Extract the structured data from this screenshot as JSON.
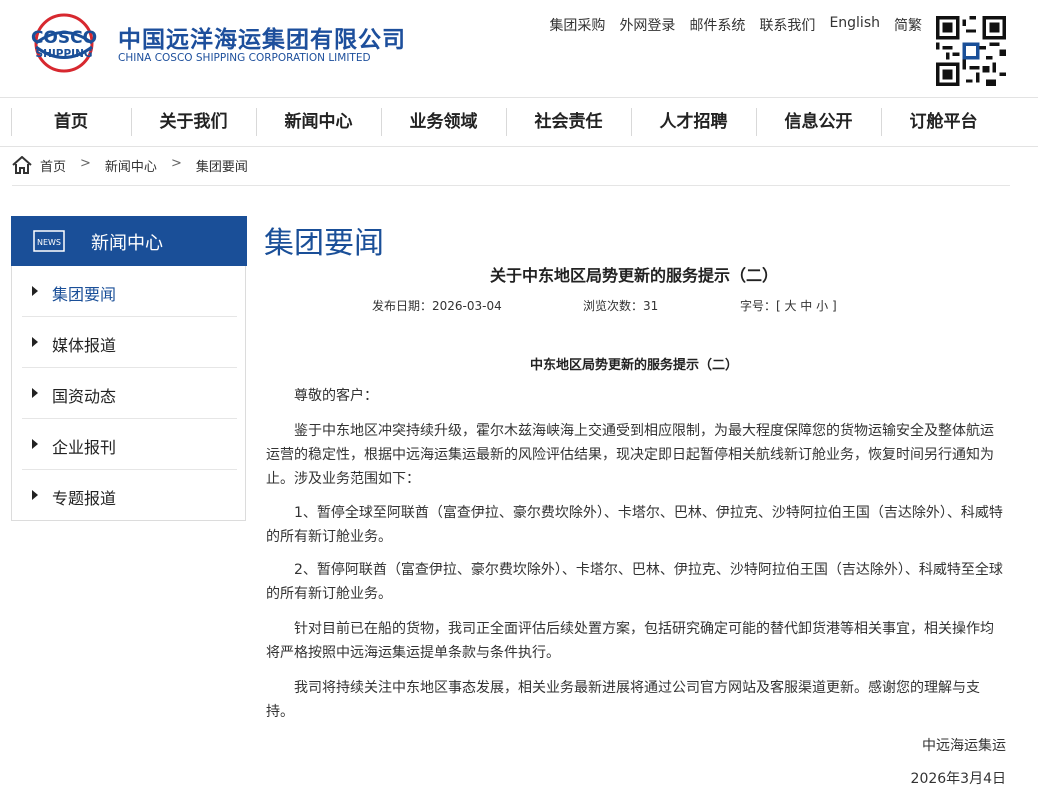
{
  "brand": {
    "logo_text": "COSCO SHIPPING",
    "name_cn": "中国远洋海运集团有限公司",
    "name_en": "CHINA COSCO SHIPPING CORPORATION LIMITED",
    "accent": "#1a4f98",
    "logo_red": "#d7282f"
  },
  "top_links": [
    "集团采购",
    "外网登录",
    "邮件系统",
    "联系我们",
    "English",
    "简繁"
  ],
  "nav": [
    "首页",
    "关于我们",
    "新闻中心",
    "业务领域",
    "社会责任",
    "人才招聘",
    "信息公开",
    "订舱平台"
  ],
  "breadcrumb": {
    "home": "首页",
    "sep": ">",
    "level1": "新闻中心",
    "level2": "集团要闻"
  },
  "sidebar": {
    "icon_text": "NEWS",
    "title": "新闻中心",
    "items": [
      "集团要闻",
      "媒体报道",
      "国资动态",
      "企业报刊",
      "专题报道"
    ]
  },
  "article": {
    "section_title": "集团要闻",
    "title": "关于中东地区局势更新的服务提示（二）",
    "publish_date": "发布日期：2026-03-04",
    "views": "浏览次数：31",
    "font_size": "字号：[ 大 中 小 ]",
    "sub_title": "中东地区局势更新的服务提示（二）",
    "paragraphs": [
      "尊敬的客户：",
      "鉴于中东地区冲突持续升级，霍尔木兹海峡海上交通受到相应限制，为最大程度保障您的货物运输安全及整体航运运营的稳定性，根据中远海运集运最新的风险评估结果，现决定即日起暂停相关航线新订舱业务，恢复时间另行通知为止。涉及业务范围如下：",
      "1、暂停全球至阿联酋（富查伊拉、豪尔费坎除外）、卡塔尔、巴林、伊拉克、沙特阿拉伯王国（吉达除外）、科威特的所有新订舱业务。",
      "2、暂停阿联酋（富查伊拉、豪尔费坎除外）、卡塔尔、巴林、伊拉克、沙特阿拉伯王国（吉达除外）、科威特至全球的所有新订舱业务。",
      "针对目前已在船的货物，我司正全面评估后续处置方案，包括研究确定可能的替代卸货港等相关事宜，相关操作均将严格按照中远海运集运提单条款与条件执行。",
      "我司将持续关注中东地区事态发展，相关业务最新进展将通过公司官方网站及客服渠道更新。感谢您的理解与支持。"
    ],
    "signature": "中远海运集运",
    "date": "2026年3月4日"
  }
}
